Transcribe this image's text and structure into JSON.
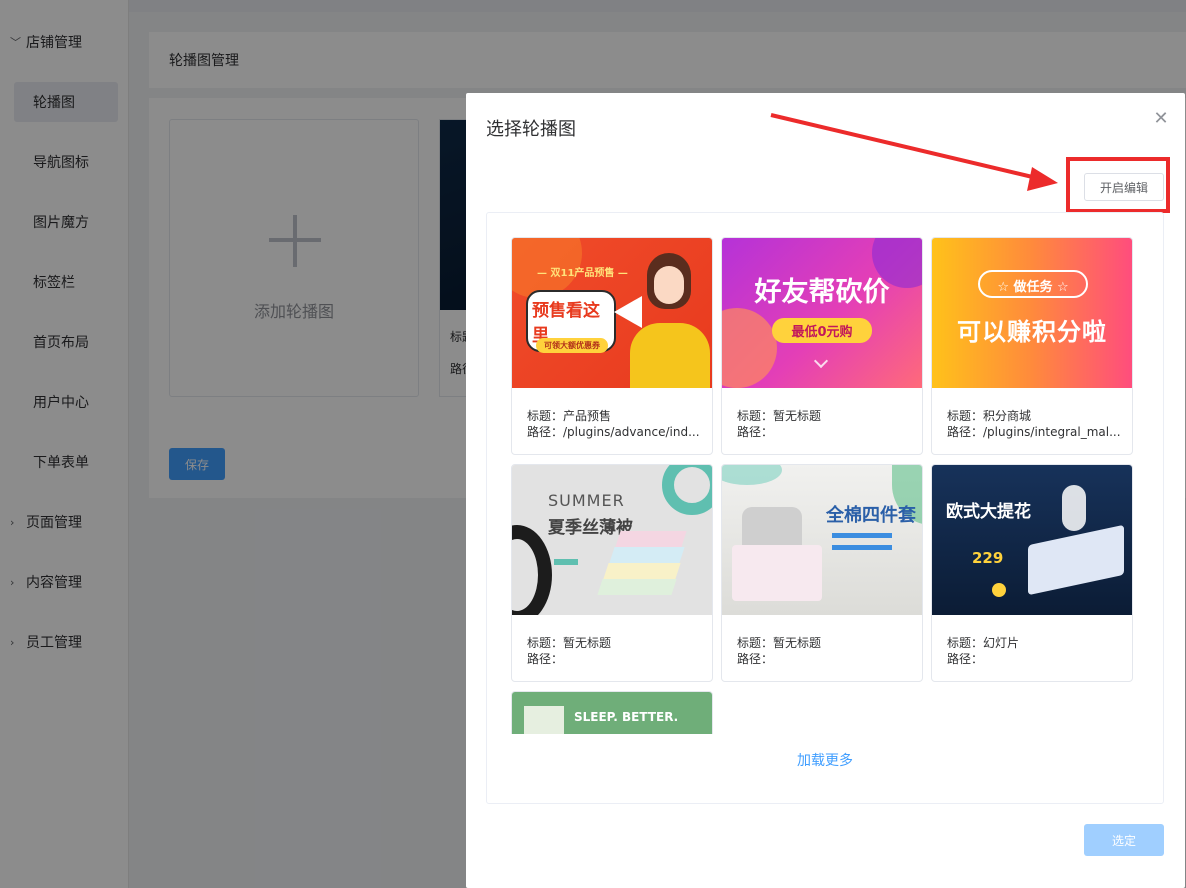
{
  "sidebar": {
    "groups": [
      {
        "label": "店铺管理",
        "expanded": true
      },
      {
        "label": "页面管理",
        "expanded": false
      },
      {
        "label": "内容管理",
        "expanded": false
      },
      {
        "label": "员工管理",
        "expanded": false
      }
    ],
    "items": [
      "轮播图",
      "导航图标",
      "图片魔方",
      "标签栏",
      "首页布局",
      "用户中心",
      "下单表单"
    ],
    "active_item": "轮播图"
  },
  "page": {
    "title": "轮播图管理",
    "add_label": "添加轮播图",
    "bg_card_title_prefix": "标题",
    "bg_card_path_prefix": "路径",
    "save_label": "保存"
  },
  "dialog": {
    "title": "选择轮播图",
    "close_icon": "close-icon",
    "edit_button": "开启编辑",
    "load_more": "加载更多",
    "confirm_button": "选定",
    "cards": [
      {
        "title": "标题：产品预售",
        "path": "路径：/plugins/advance/ind...",
        "banner_lines": [
          "— 双11产品预售 —",
          "预售看这里",
          "可领大额优惠券"
        ]
      },
      {
        "title": "标题：暂无标题",
        "path": "路径：",
        "banner_lines": [
          "好友帮砍价",
          "最低0元购"
        ]
      },
      {
        "title": "标题：积分商城",
        "path": "路径：/plugins/integral_mal...",
        "banner_lines": [
          "☆ 做任务 ☆",
          "可以赚积分啦"
        ]
      },
      {
        "title": "标题：暂无标题",
        "path": "路径：",
        "banner_lines": [
          "SUMMER",
          "夏季丝薄被"
        ]
      },
      {
        "title": "标题：暂无标题",
        "path": "路径：",
        "banner_lines": [
          "全棉四件套"
        ]
      },
      {
        "title": "标题：幻灯片",
        "path": "路径：",
        "banner_lines": [
          "欧式大提花",
          "229"
        ]
      },
      {
        "title": "",
        "path": "",
        "banner_lines": [
          "SLEEP. BETTER."
        ]
      }
    ]
  },
  "colors": {
    "accent": "#409eff",
    "accent_disabled": "#a0cfff",
    "highlight": "#ec2b2b"
  }
}
